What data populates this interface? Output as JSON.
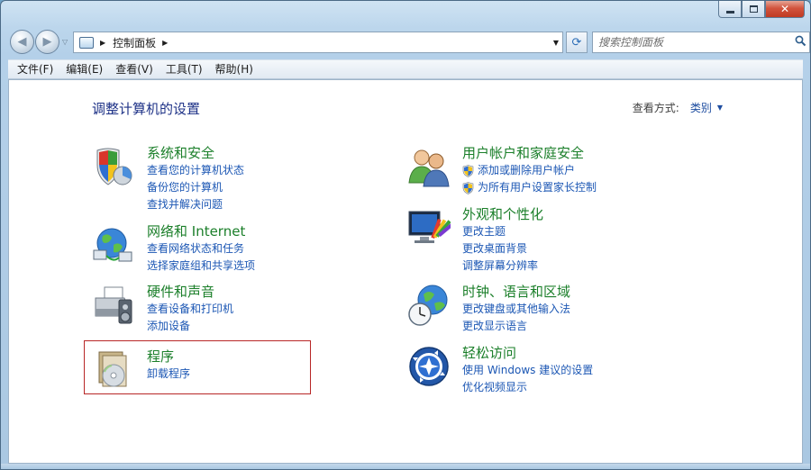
{
  "window": {
    "caption": {
      "minimize": "",
      "maximize": "",
      "close": "✕"
    }
  },
  "nav": {
    "back_glyph": "◀",
    "forward_glyph": "▶",
    "history_glyph": "▽",
    "breadcrumb": "控制面板",
    "refresh_glyph": "⟳",
    "search_placeholder": "搜索控制面板",
    "search_glyph": "⚲"
  },
  "menubar": {
    "items": [
      "文件(F)",
      "编辑(E)",
      "查看(V)",
      "工具(T)",
      "帮助(H)"
    ]
  },
  "content": {
    "title": "调整计算机的设置",
    "view_by_label": "查看方式:",
    "view_by_value": "类别",
    "categories": [
      {
        "title": "系统和安全",
        "icon": "shield-icon",
        "links": [
          "查看您的计算机状态",
          "备份您的计算机",
          "查找并解决问题"
        ]
      },
      {
        "title": "网络和 Internet",
        "icon": "network-globe-icon",
        "links": [
          "查看网络状态和任务",
          "选择家庭组和共享选项"
        ]
      },
      {
        "title": "硬件和声音",
        "icon": "printer-speaker-icon",
        "links": [
          "查看设备和打印机",
          "添加设备"
        ]
      },
      {
        "title": "程序",
        "icon": "programs-disc-icon",
        "links": [
          "卸载程序"
        ]
      },
      {
        "title": "用户帐户和家庭安全",
        "icon": "users-icon",
        "links": [
          "添加或删除用户帐户",
          "为所有用户设置家长控制"
        ]
      },
      {
        "title": "外观和个性化",
        "icon": "monitor-paint-icon",
        "links": [
          "更改主题",
          "更改桌面背景",
          "调整屏幕分辨率"
        ]
      },
      {
        "title": "时钟、语言和区域",
        "icon": "clock-globe-icon",
        "links": [
          "更改键盘或其他输入法",
          "更改显示语言"
        ]
      },
      {
        "title": "轻松访问",
        "icon": "ease-of-access-icon",
        "links": [
          "使用 Windows 建议的设置",
          "优化视频显示"
        ]
      }
    ]
  },
  "colors": {
    "category_title": "#1b7f2a",
    "link": "#1c57b4",
    "page_title": "#1e3287",
    "selection_border": "#b82626"
  }
}
